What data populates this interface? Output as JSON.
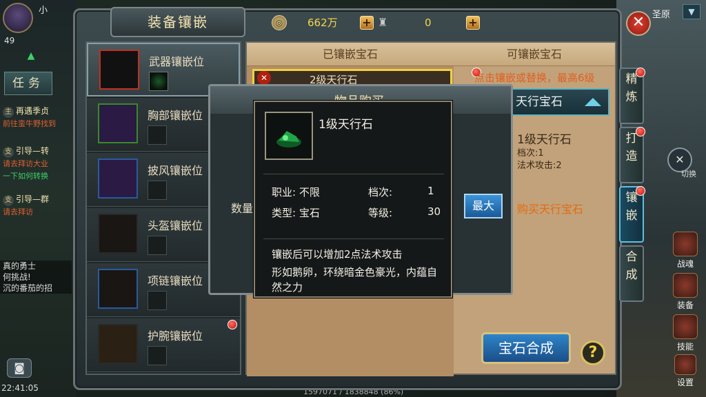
{
  "hud": {
    "level": "49",
    "player_name": "小",
    "server": "圣原",
    "task_tab": "任务",
    "quests": [
      {
        "tag": "主",
        "title": "再遇季贞",
        "desc": "前往蛮牛野找到"
      },
      {
        "tag": "支",
        "title": "引导—转",
        "desc": "请去拜访大业",
        "desc_link": "一下如何转换"
      },
      {
        "tag": "支",
        "title": "引导—群",
        "desc": "请去拜访"
      }
    ],
    "chat": [
      "真的勇士",
      "何挑战!",
      "沉的番茄的招"
    ],
    "clock": "22:41:05",
    "progress": "1597071 / 1838848 (86%)",
    "right_items": [
      "战魂",
      "装备",
      "技能",
      "设置"
    ],
    "switch_label": "切换"
  },
  "panel": {
    "title": "装备镶嵌",
    "gold": "662万",
    "tokens": "0",
    "tabs": [
      "精炼",
      "打造",
      "镶嵌",
      "合成"
    ],
    "active_tab_index": 2
  },
  "slots": [
    {
      "label": "武器镶嵌位",
      "has_gem": true,
      "red_dot": false
    },
    {
      "label": "胸部镶嵌位",
      "has_gem": false,
      "red_dot": false
    },
    {
      "label": "披风镶嵌位",
      "has_gem": false,
      "red_dot": false
    },
    {
      "label": "头盔镶嵌位",
      "has_gem": false,
      "red_dot": false
    },
    {
      "label": "项链镶嵌位",
      "has_gem": false,
      "red_dot": false
    },
    {
      "label": "护腕镶嵌位",
      "has_gem": false,
      "red_dot": true
    }
  ],
  "content": {
    "embedded_header": "已镶嵌宝石",
    "available_header": "可镶嵌宝石",
    "embedded_item": "2级天行石",
    "hint": "点击镶嵌或替换，最高6级",
    "gem_select": "天行宝石",
    "gem_card": {
      "name": "1级天行石",
      "grade": "档次:1",
      "attr": "法术攻击:2"
    },
    "buy_link": "购买天行宝石",
    "synth_button": "宝石合成",
    "help": "?"
  },
  "modal": {
    "title": "物品购买",
    "qty_label": "数量",
    "max_button": "最大"
  },
  "tooltip": {
    "name": "1级天行石",
    "job_label": "职业:",
    "job_value": "不限",
    "grade_label": "档次:",
    "grade_value": "1",
    "type_label": "类型:",
    "type_value": "宝石",
    "level_label": "等级:",
    "level_value": "30",
    "effect": "镶嵌后可以增加2点法术攻击",
    "description": "形如鹅卵，环绕暗金色豪光，内蕴自然之力"
  },
  "colors": {
    "accent_orange": "#e06020",
    "gold_text": "#f6d64a",
    "tab_active": "#5fc0e0"
  }
}
